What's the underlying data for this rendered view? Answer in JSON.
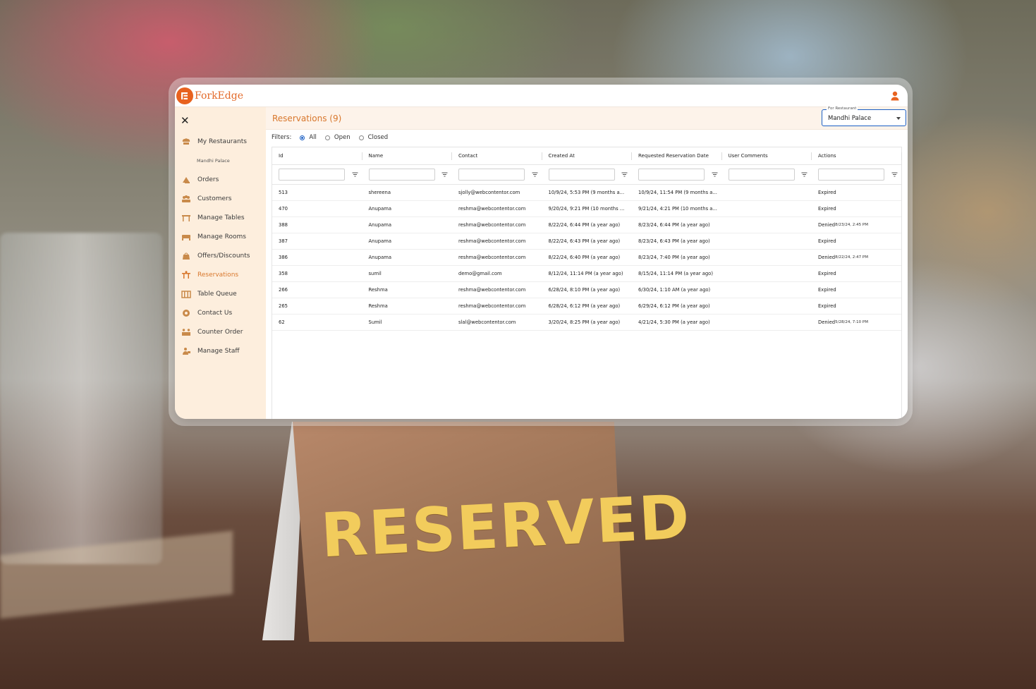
{
  "brand": {
    "name": "ForkEdge",
    "accent": "#e8621f"
  },
  "sidebar": {
    "items": [
      {
        "label": "My Restaurants",
        "icon": "chef-hat-icon"
      },
      {
        "label": "Mandhi Palace",
        "icon": "",
        "sub": true
      },
      {
        "label": "Orders",
        "icon": "orders-icon"
      },
      {
        "label": "Customers",
        "icon": "customers-icon"
      },
      {
        "label": "Manage Tables",
        "icon": "table-icon"
      },
      {
        "label": "Manage Rooms",
        "icon": "bed-icon"
      },
      {
        "label": "Offers/Discounts",
        "icon": "offer-bag-icon"
      },
      {
        "label": "Reservations",
        "icon": "reservation-icon",
        "active": true
      },
      {
        "label": "Table Queue",
        "icon": "queue-icon"
      },
      {
        "label": "Contact Us",
        "icon": "contact-icon"
      },
      {
        "label": "Counter Order",
        "icon": "counter-icon"
      },
      {
        "label": "Manage Staff",
        "icon": "staff-icon"
      }
    ]
  },
  "main": {
    "title": "Reservations (9)",
    "restaurant_select": {
      "label": "For Restaurant",
      "value": "Mandhi Palace"
    },
    "filters": {
      "label": "Filters:",
      "options": [
        "All",
        "Open",
        "Closed"
      ],
      "selected": "All"
    }
  },
  "table": {
    "columns": [
      "Id",
      "Name",
      "Contact",
      "Created At",
      "Requested Reservation Date",
      "User Comments",
      "Actions"
    ],
    "rows": [
      {
        "id": "513",
        "name": "shereena",
        "contact": "sjolly@webcontentor.com",
        "created": "10/9/24, 5:53 PM (9 months a...",
        "requested": "10/9/24, 11:54 PM (9 months a...",
        "comments": "",
        "action": "Expired",
        "action_time": ""
      },
      {
        "id": "470",
        "name": "Anupama",
        "contact": "reshma@webcontentor.com",
        "created": "9/20/24, 9:21 PM (10 months ...",
        "requested": "9/21/24, 4:21 PM (10 months a...",
        "comments": "",
        "action": "Expired",
        "action_time": ""
      },
      {
        "id": "388",
        "name": "Anupama",
        "contact": "reshma@webcontentor.com",
        "created": "8/22/24, 6:44 PM (a year ago)",
        "requested": "8/23/24, 6:44 PM (a year ago)",
        "comments": "",
        "action": "Denied",
        "action_time": "8/23/24, 2:45 PM"
      },
      {
        "id": "387",
        "name": "Anupama",
        "contact": "reshma@webcontentor.com",
        "created": "8/22/24, 6:43 PM (a year ago)",
        "requested": "8/23/24, 6:43 PM (a year ago)",
        "comments": "",
        "action": "Expired",
        "action_time": ""
      },
      {
        "id": "386",
        "name": "Anupama",
        "contact": "reshma@webcontentor.com",
        "created": "8/22/24, 6:40 PM (a year ago)",
        "requested": "8/23/24, 7:40 PM (a year ago)",
        "comments": "",
        "action": "Denied",
        "action_time": "8/22/24, 2:47 PM"
      },
      {
        "id": "358",
        "name": "sumil",
        "contact": "demo@gmail.com",
        "created": "8/12/24, 11:14 PM (a year ago)",
        "requested": "8/15/24, 11:14 PM (a year ago)",
        "comments": "",
        "action": "Expired",
        "action_time": ""
      },
      {
        "id": "266",
        "name": "Reshma",
        "contact": "reshma@webcontentor.com",
        "created": "6/28/24, 8:10 PM (a year ago)",
        "requested": "6/30/24, 1:10 AM (a year ago)",
        "comments": "",
        "action": "Expired",
        "action_time": ""
      },
      {
        "id": "265",
        "name": "Reshma",
        "contact": "reshma@webcontentor.com",
        "created": "6/28/24, 6:12 PM (a year ago)",
        "requested": "6/29/24, 6:12 PM (a year ago)",
        "comments": "",
        "action": "Expired",
        "action_time": ""
      },
      {
        "id": "62",
        "name": "Sumil",
        "contact": "slal@webcontentor.com",
        "created": "3/20/24, 8:25 PM (a year ago)",
        "requested": "4/21/24, 5:30 PM (a year ago)",
        "comments": "",
        "action": "Denied",
        "action_time": "5/28/24, 7:10 PM"
      }
    ]
  },
  "background": {
    "sign_text": "RESERVED",
    "sign_text_color": "#f2cc5c"
  }
}
